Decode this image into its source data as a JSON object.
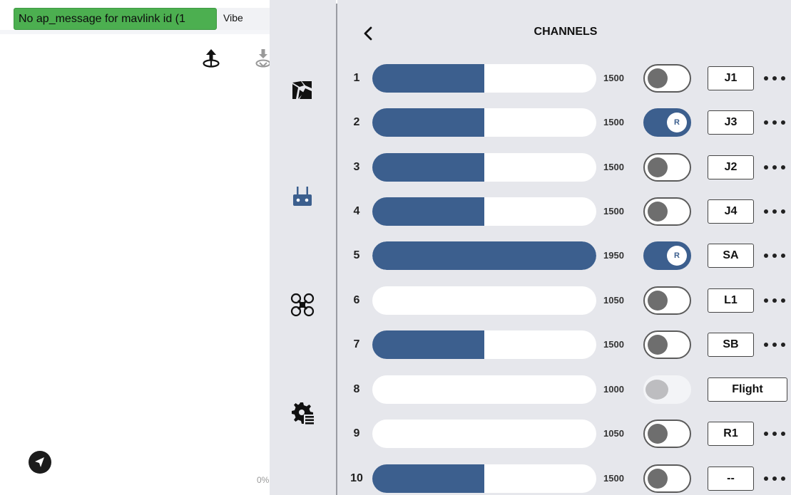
{
  "status": {
    "message": "No ap_message for mavlink id (1",
    "vibe_label": "Vibe",
    "percent_label": "0%",
    "accent_color": "#4caf50"
  },
  "rail": {
    "icons": [
      "camera-gimbal-icon",
      "radio-controller-icon",
      "drone-icon",
      "settings-list-icon"
    ]
  },
  "panel": {
    "title": "CHANNELS",
    "accent_color": "#3c5f8e",
    "channels": [
      {
        "num": "1",
        "value": "1500",
        "fill": 0.5,
        "toggle": "off",
        "toggle_label": "",
        "assign": "J1",
        "more": true
      },
      {
        "num": "2",
        "value": "1500",
        "fill": 0.5,
        "toggle": "on",
        "toggle_label": "R",
        "assign": "J3",
        "more": true
      },
      {
        "num": "3",
        "value": "1500",
        "fill": 0.5,
        "toggle": "off",
        "toggle_label": "",
        "assign": "J2",
        "more": true
      },
      {
        "num": "4",
        "value": "1500",
        "fill": 0.5,
        "toggle": "off",
        "toggle_label": "",
        "assign": "J4",
        "more": true
      },
      {
        "num": "5",
        "value": "1950",
        "fill": 1.0,
        "toggle": "on",
        "toggle_label": "R",
        "assign": "SA",
        "more": true
      },
      {
        "num": "6",
        "value": "1050",
        "fill": 0.0,
        "toggle": "off",
        "toggle_label": "",
        "assign": "L1",
        "more": true
      },
      {
        "num": "7",
        "value": "1500",
        "fill": 0.5,
        "toggle": "off",
        "toggle_label": "",
        "assign": "SB",
        "more": true
      },
      {
        "num": "8",
        "value": "1000",
        "fill": 0.0,
        "toggle": "disabled",
        "toggle_label": "",
        "assign": "Flight",
        "more": false
      },
      {
        "num": "9",
        "value": "1050",
        "fill": 0.0,
        "toggle": "off",
        "toggle_label": "",
        "assign": "R1",
        "more": true
      },
      {
        "num": "10",
        "value": "1500",
        "fill": 0.5,
        "toggle": "off",
        "toggle_label": "",
        "assign": "--",
        "more": true
      }
    ]
  }
}
